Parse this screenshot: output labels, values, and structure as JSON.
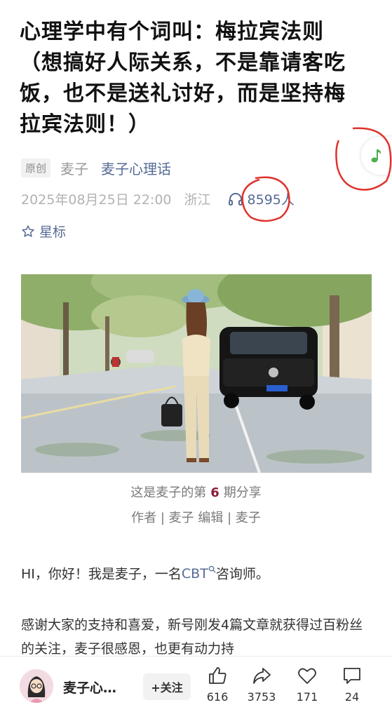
{
  "article": {
    "title": "心理学中有个词叫：梅拉宾法则（想搞好人际关系，不是靠请客吃饭，也不是送礼讨好，而是坚持梅拉宾法则！）",
    "original_badge": "原创",
    "author": "麦子",
    "account": "麦子心理话",
    "date": "2025年08月25日 22:00",
    "location": "浙江",
    "listen_count": "8595人",
    "star_label": "星标",
    "caption_prefix": "这是麦子的第",
    "caption_number": "6",
    "caption_suffix": "期分享",
    "credits": "作者 | 麦子 编辑 | 麦子",
    "p1_before": "HI，你好！我是麦子，一名",
    "p1_link": "CBT",
    "p1_after": "咨询师。",
    "p2": "感谢大家的支持和喜爱，新号刚发4篇文章就获得过百粉丝的关注，麦子很感恩，也更有动力持"
  },
  "bottom_bar": {
    "account_short": "麦子心…",
    "follow_label": "+关注",
    "like_count": "616",
    "share_count": "3753",
    "favorite_count": "171",
    "comment_count": "24"
  },
  "icons": [
    "music-note-icon",
    "headphones-icon",
    "star-icon",
    "search-icon",
    "thumb-up-icon",
    "share-icon",
    "heart-icon",
    "comment-icon"
  ],
  "colors": {
    "link": "#576b95",
    "accent_number": "#8b1c3c",
    "music_note": "#4caf50",
    "annotation_red": "#e0322d"
  }
}
